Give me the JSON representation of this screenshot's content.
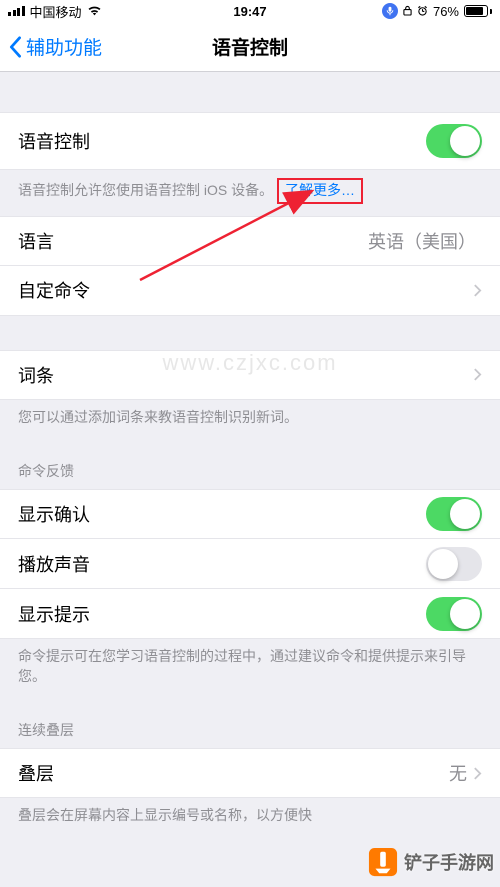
{
  "status": {
    "carrier": "中国移动",
    "time": "19:47",
    "battery_pct": "76%"
  },
  "nav": {
    "back_label": "辅助功能",
    "title": "语音控制"
  },
  "voice_control": {
    "label": "语音控制",
    "enabled": true,
    "footer_prefix": "语音控制允许您使用语音控制 iOS 设备。",
    "learn_more": "了解更多…"
  },
  "language": {
    "label": "语言",
    "value": "英语（美国）"
  },
  "custom_commands": {
    "label": "自定命令"
  },
  "vocabulary": {
    "label": "词条",
    "footer": "您可以通过添加词条来教语音控制识别新词。"
  },
  "feedback": {
    "header": "命令反馈",
    "show_confirmation": {
      "label": "显示确认",
      "enabled": true
    },
    "play_sound": {
      "label": "播放声音",
      "enabled": false
    },
    "show_hints": {
      "label": "显示提示",
      "enabled": true
    },
    "footer": "命令提示可在您学习语音控制的过程中，通过建议命令和提供提示来引导您。"
  },
  "overlay": {
    "header": "连续叠层",
    "label": "叠层",
    "value": "无",
    "footer": "叠层会在屏幕内容上显示编号或名称，以方便快"
  },
  "watermarks": {
    "site": "www.czjxc.com",
    "brand": "铲子手游网"
  }
}
